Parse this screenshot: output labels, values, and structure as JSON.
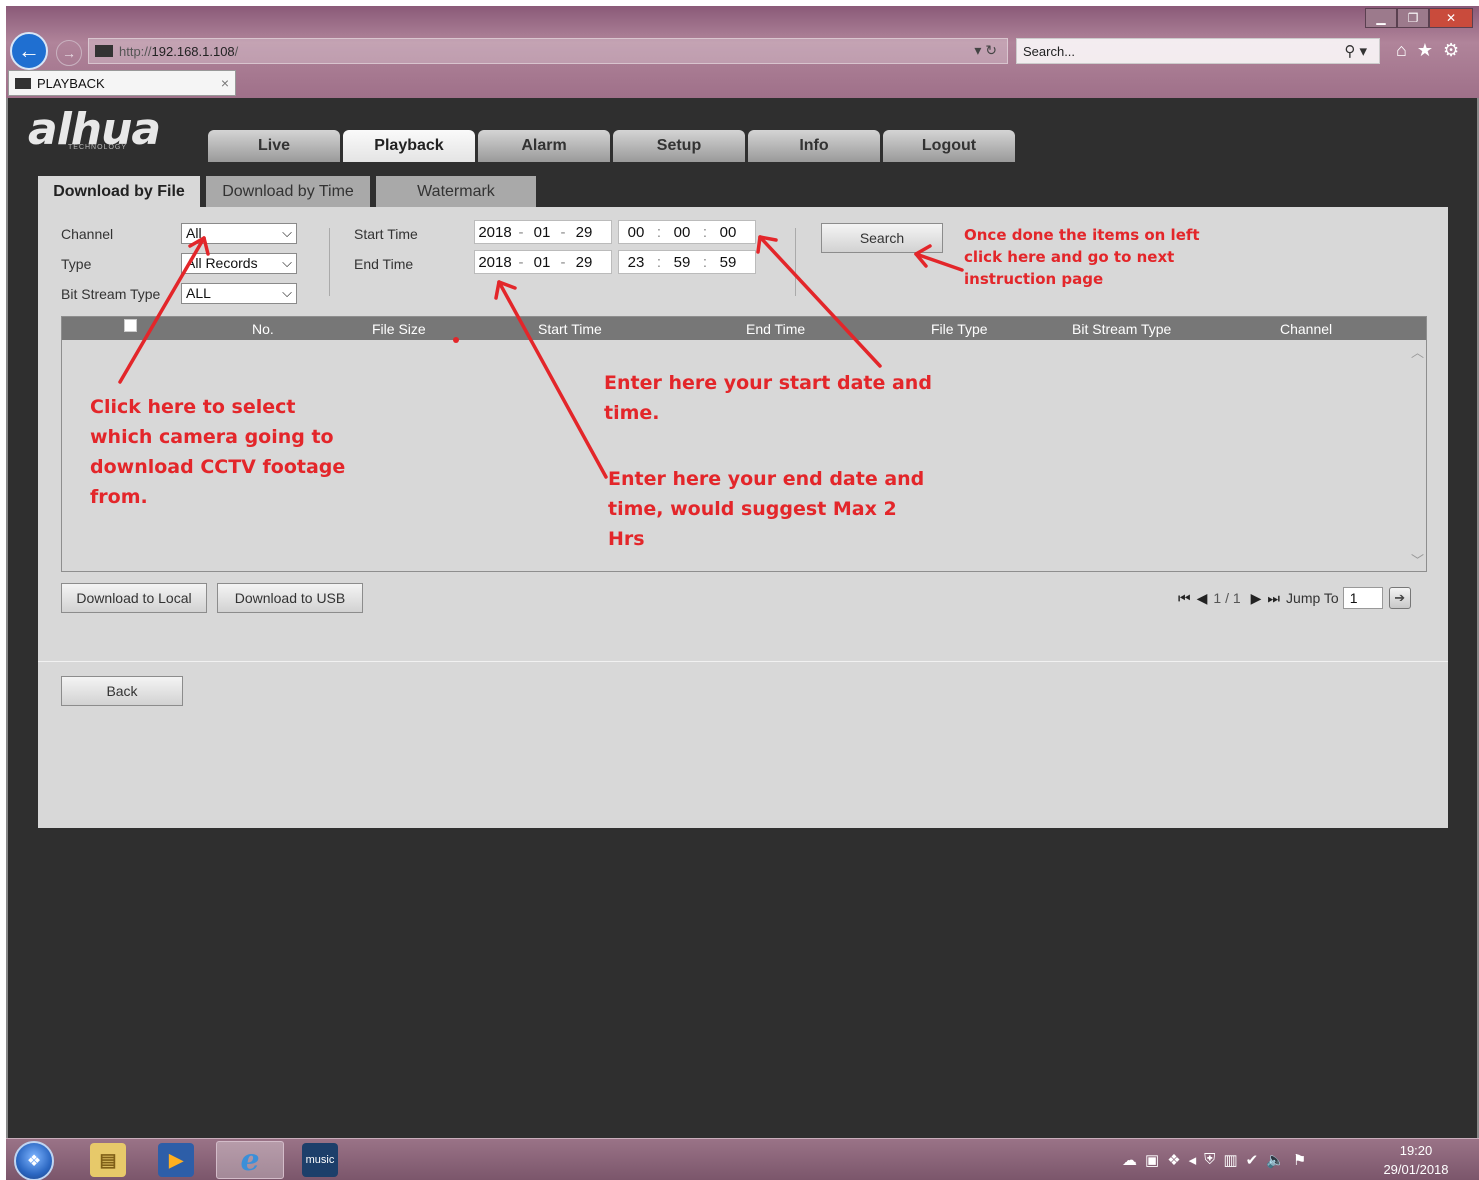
{
  "browser": {
    "url_protocol": "http://",
    "url_host": "192.168.1.108",
    "url_suffix": "/",
    "search_placeholder": "Search...",
    "tab_title": "PLAYBACK",
    "tab_close": "×",
    "icons": [
      "back-arrow-icon",
      "forward-arrow-icon",
      "refresh-icon",
      "search-icon",
      "home-icon",
      "star-icon",
      "gear-icon"
    ]
  },
  "app": {
    "logo": "alhua",
    "logo_sub": "TECHNOLOGY",
    "main_tabs": [
      {
        "label": "Live"
      },
      {
        "label": "Playback"
      },
      {
        "label": "Alarm"
      },
      {
        "label": "Setup"
      },
      {
        "label": "Info"
      },
      {
        "label": "Logout"
      }
    ],
    "active_main_tab": "Playback",
    "sub_tabs": [
      {
        "label": "Download by File"
      },
      {
        "label": "Download by Time"
      },
      {
        "label": "Watermark"
      }
    ],
    "active_sub_tab": "Download by File",
    "filters": {
      "channel_label": "Channel",
      "channel_value": "All",
      "type_label": "Type",
      "type_value": "All Records",
      "bitstream_label": "Bit Stream Type",
      "bitstream_value": "ALL",
      "start_label": "Start Time",
      "end_label": "End Time",
      "start": {
        "year": "2018",
        "month": "01",
        "day": "29",
        "hour": "00",
        "minute": "00",
        "second": "00"
      },
      "end": {
        "year": "2018",
        "month": "01",
        "day": "29",
        "hour": "23",
        "minute": "59",
        "second": "59"
      },
      "date_sep": "-",
      "time_sep": ":",
      "search_label": "Search"
    },
    "table": {
      "columns": [
        "No.",
        "File Size",
        "Start Time",
        "End Time",
        "File Type",
        "Bit Stream Type",
        "Channel"
      ],
      "rows": []
    },
    "buttons": {
      "download_local": "Download to Local",
      "download_usb": "Download to USB",
      "back": "Back"
    },
    "pager": {
      "page_text": "1 / 1",
      "jump_label": "Jump To",
      "jump_value": "1"
    }
  },
  "annotations": {
    "search_note": [
      "Once done the items on left",
      "click here and go to next",
      "instruction page"
    ],
    "start_note": [
      "Enter here your start date and",
      "time."
    ],
    "end_note": [
      "Enter here your end date and",
      "time, would suggest Max 2",
      "Hrs"
    ],
    "channel_note": [
      "Click here to select",
      "which camera going to",
      "download CCTV footage",
      "from."
    ],
    "color": "#e3262a"
  },
  "taskbar": {
    "music_label": "music",
    "clock_time": "19:20",
    "clock_date": "29/01/2018"
  }
}
